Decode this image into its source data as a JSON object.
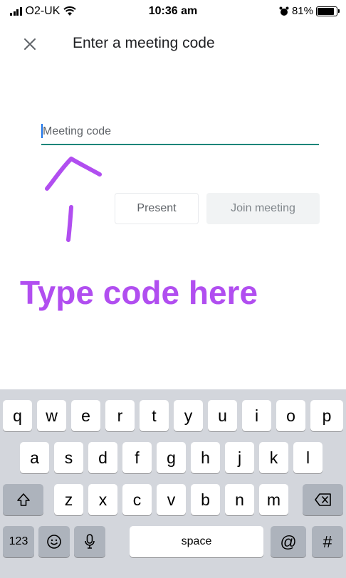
{
  "status_bar": {
    "carrier": "O2-UK",
    "time": "10:36 am",
    "battery_percent": "81%",
    "battery_level": 0.81
  },
  "app_bar": {
    "close_icon": "close-icon",
    "title": "Enter a meeting code"
  },
  "form": {
    "meeting_code_placeholder": "Meeting code",
    "meeting_code_value": "",
    "present_label": "Present",
    "join_label": "Join meeting"
  },
  "annotation": {
    "text": "Type code here",
    "color": "#b14ef0"
  },
  "colors": {
    "field_underline": "#12857a",
    "caret": "#1a73e8"
  },
  "keyboard": {
    "row1": [
      "q",
      "w",
      "e",
      "r",
      "t",
      "y",
      "u",
      "i",
      "o",
      "p"
    ],
    "row2": [
      "a",
      "s",
      "d",
      "f",
      "g",
      "h",
      "j",
      "k",
      "l"
    ],
    "row3": [
      "z",
      "x",
      "c",
      "v",
      "b",
      "n",
      "m"
    ],
    "shift_icon": "shift-icon",
    "backspace_icon": "backspace-icon",
    "numbers_label": "123",
    "emoji_icon": "emoji-icon",
    "mic_icon": "microphone-icon",
    "space_label": "space",
    "at_label": "@",
    "hash_label": "#"
  }
}
